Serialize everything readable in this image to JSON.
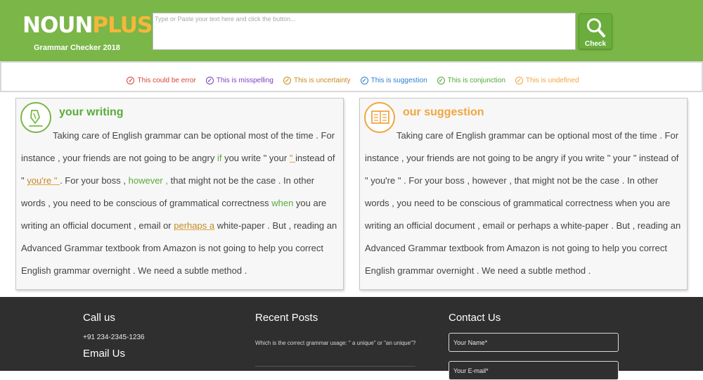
{
  "header": {
    "logo_part1": "NOUN",
    "logo_part2": "PLUS",
    "subtitle": "Grammar Checker 2018",
    "input_placeholder": "Type or Paste your text here and click the button...",
    "check_label": "Check"
  },
  "legend": [
    {
      "label": "This could be error",
      "color": "#d9443a"
    },
    {
      "label": "This is misspelling",
      "color": "#7a3fc4"
    },
    {
      "label": "This is uncertainty",
      "color": "#c98a1e"
    },
    {
      "label": "This is suggestion",
      "color": "#2f7fd0"
    },
    {
      "label": "This is conjunction",
      "color": "#4ea83a"
    },
    {
      "label": "This is undefined",
      "color": "#f0a640"
    }
  ],
  "writing": {
    "title": "your writing",
    "t1": "Taking care of English grammar can be optional most of the time . For instance , your friends are not going to be angry ",
    "w_if": "if",
    "t2": " you write \" your ",
    "w_quote": "\" ",
    "t3": "instead of \" ",
    "w_youre": "you're \" ",
    "t4": ". For your boss , ",
    "w_however": "however ,",
    "t5": " that might not be the case . In other words , you need to be conscious of grammatical correctness ",
    "w_when": "when",
    "t6": " you are writing an official document , email or ",
    "w_perhaps": "perhaps a",
    "t7": " white-paper . But , reading an Advanced Grammar textbook from Amazon is not going to help you correct English grammar overnight . We need a subtle method ."
  },
  "suggestion": {
    "title": "our suggestion",
    "text": "Taking care of English grammar can be optional most of the time . For instance , your friends are not going to be angry if you write \" your \" instead of \" you're \" . For your boss , however , that might not be the case . In other words , you need to be conscious of grammatical correctness when you are writing an official document , email or perhaps a white-paper . But , reading an Advanced Grammar textbook from Amazon is not going to help you correct English grammar overnight . We need a subtle method ."
  },
  "footer": {
    "call_heading": "Call us",
    "phone": "+91 234-2345-1236",
    "email_heading": "Email Us",
    "posts_heading": "Recent Posts",
    "post1": "Which is the correct grammar usage: \" a unique\" or \"an unique\"?",
    "contact_heading": "Contact Us",
    "name_placeholder": "Your Name*",
    "email_placeholder": "Your E-mail*"
  }
}
